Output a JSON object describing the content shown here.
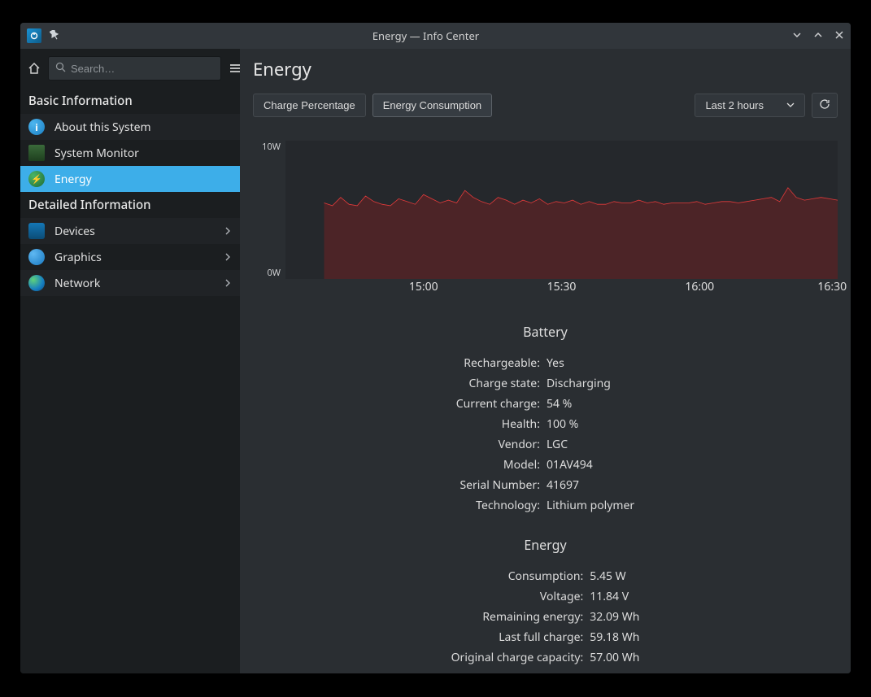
{
  "window": {
    "title": "Energy — Info Center"
  },
  "search": {
    "placeholder": "Search…"
  },
  "sidebar": {
    "sections": [
      {
        "title": "Basic Information"
      },
      {
        "title": "Detailed Information"
      }
    ],
    "basic": [
      {
        "label": "About this System"
      },
      {
        "label": "System Monitor"
      },
      {
        "label": "Energy"
      }
    ],
    "detailed": [
      {
        "label": "Devices"
      },
      {
        "label": "Graphics"
      },
      {
        "label": "Network"
      }
    ]
  },
  "main": {
    "title": "Energy",
    "tabs": {
      "charge": "Charge Percentage",
      "consumption": "Energy Consumption"
    },
    "range_selected": "Last 2 hours"
  },
  "chart_data": {
    "type": "area",
    "title": "",
    "xlabel": "",
    "ylabel": "",
    "ylim": [
      0,
      10
    ],
    "y_ticks": [
      "10W",
      "0W"
    ],
    "x_ticks": [
      "15:00",
      "15:30",
      "16:00",
      "16:30"
    ],
    "x_tick_positions_pct": [
      25,
      50,
      75,
      99
    ],
    "series": [
      {
        "name": "consumption_watts",
        "color": "#e33b3b",
        "start_pct": 7,
        "values": [
          5.5,
          5.3,
          5.9,
          5.4,
          5.3,
          6.0,
          5.6,
          5.4,
          5.3,
          5.8,
          5.6,
          5.4,
          6.1,
          5.8,
          5.5,
          5.7,
          5.5,
          6.4,
          5.9,
          5.6,
          5.4,
          5.9,
          5.7,
          5.4,
          5.7,
          5.5,
          5.8,
          5.4,
          5.6,
          5.5,
          5.7,
          5.4,
          5.6,
          5.4,
          5.4,
          5.6,
          5.5,
          5.5,
          5.7,
          5.5,
          5.6,
          5.4,
          5.5,
          5.5,
          5.5,
          5.6,
          5.4,
          5.5,
          5.6,
          5.6,
          5.5,
          5.6,
          5.7,
          5.8,
          5.9,
          5.6,
          6.6,
          5.9,
          5.7,
          5.8,
          5.9,
          5.8,
          5.7
        ]
      }
    ]
  },
  "battery": {
    "section_title": "Battery",
    "rows": [
      {
        "key": "Rechargeable:",
        "val": "Yes"
      },
      {
        "key": "Charge state:",
        "val": "Discharging"
      },
      {
        "key": "Current charge:",
        "val": "54 %"
      },
      {
        "key": "Health:",
        "val": "100 %"
      },
      {
        "key": "Vendor:",
        "val": "LGC"
      },
      {
        "key": "Model:",
        "val": "01AV494"
      },
      {
        "key": "Serial Number:",
        "val": "41697"
      },
      {
        "key": "Technology:",
        "val": "Lithium polymer"
      }
    ]
  },
  "energy": {
    "section_title": "Energy",
    "rows": [
      {
        "key": "Consumption:",
        "val": "5.45 W"
      },
      {
        "key": "Voltage:",
        "val": "11.84 V"
      },
      {
        "key": "Remaining energy:",
        "val": "32.09 Wh"
      },
      {
        "key": "Last full charge:",
        "val": "59.18 Wh"
      },
      {
        "key": "Original charge capacity:",
        "val": "57.00 Wh"
      }
    ]
  }
}
